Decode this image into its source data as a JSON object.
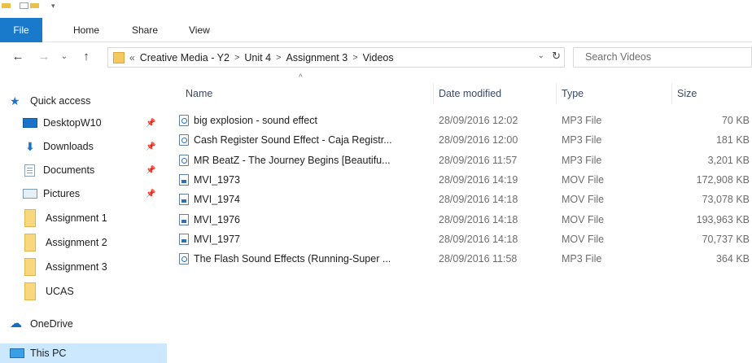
{
  "ribbon": {
    "tabs": [
      "File",
      "Home",
      "Share",
      "View"
    ]
  },
  "nav": {
    "breadcrumbs": [
      "Creative Media - Y2",
      "Unit 4",
      "Assignment 3",
      "Videos"
    ],
    "overflow": "«",
    "search_placeholder": "Search Videos"
  },
  "sidebar": {
    "items": [
      {
        "label": "Quick access",
        "icon": "star-icon"
      },
      {
        "label": "DesktopW10",
        "icon": "desktop-icon",
        "pinned": true
      },
      {
        "label": "Downloads",
        "icon": "download-icon",
        "pinned": true
      },
      {
        "label": "Documents",
        "icon": "documents-icon",
        "pinned": true
      },
      {
        "label": "Pictures",
        "icon": "pictures-icon",
        "pinned": true
      },
      {
        "label": "Assignment 1",
        "icon": "folder-icon"
      },
      {
        "label": "Assignment 2",
        "icon": "folder-icon"
      },
      {
        "label": "Assignment 3",
        "icon": "folder-icon"
      },
      {
        "label": "UCAS",
        "icon": "folder-icon"
      },
      {
        "label": "OneDrive",
        "icon": "onedrive-icon"
      },
      {
        "label": "This PC",
        "icon": "this-pc-icon",
        "selected": true
      }
    ]
  },
  "columns": {
    "name": "Name",
    "date": "Date modified",
    "type": "Type",
    "size": "Size"
  },
  "files": [
    {
      "name": "big explosion - sound effect",
      "date": "28/09/2016 12:02",
      "type": "MP3 File",
      "size": "70 KB",
      "kind": "mp3"
    },
    {
      "name": "Cash Register Sound Effect - Caja Registr...",
      "date": "28/09/2016 12:00",
      "type": "MP3 File",
      "size": "181 KB",
      "kind": "mp3"
    },
    {
      "name": "MR BeatZ - The Journey Begins [Beautifu...",
      "date": "28/09/2016 11:57",
      "type": "MP3 File",
      "size": "3,201 KB",
      "kind": "mp3"
    },
    {
      "name": "MVI_1973",
      "date": "28/09/2016 14:19",
      "type": "MOV File",
      "size": "172,908 KB",
      "kind": "mov"
    },
    {
      "name": "MVI_1974",
      "date": "28/09/2016 14:18",
      "type": "MOV File",
      "size": "73,078 KB",
      "kind": "mov"
    },
    {
      "name": "MVI_1976",
      "date": "28/09/2016 14:18",
      "type": "MOV File",
      "size": "193,963 KB",
      "kind": "mov"
    },
    {
      "name": "MVI_1977",
      "date": "28/09/2016 14:18",
      "type": "MOV File",
      "size": "70,737 KB",
      "kind": "mov"
    },
    {
      "name": "The Flash Sound Effects (Running-Super ...",
      "date": "28/09/2016 11:58",
      "type": "MP3 File",
      "size": "364 KB",
      "kind": "mp3"
    }
  ]
}
